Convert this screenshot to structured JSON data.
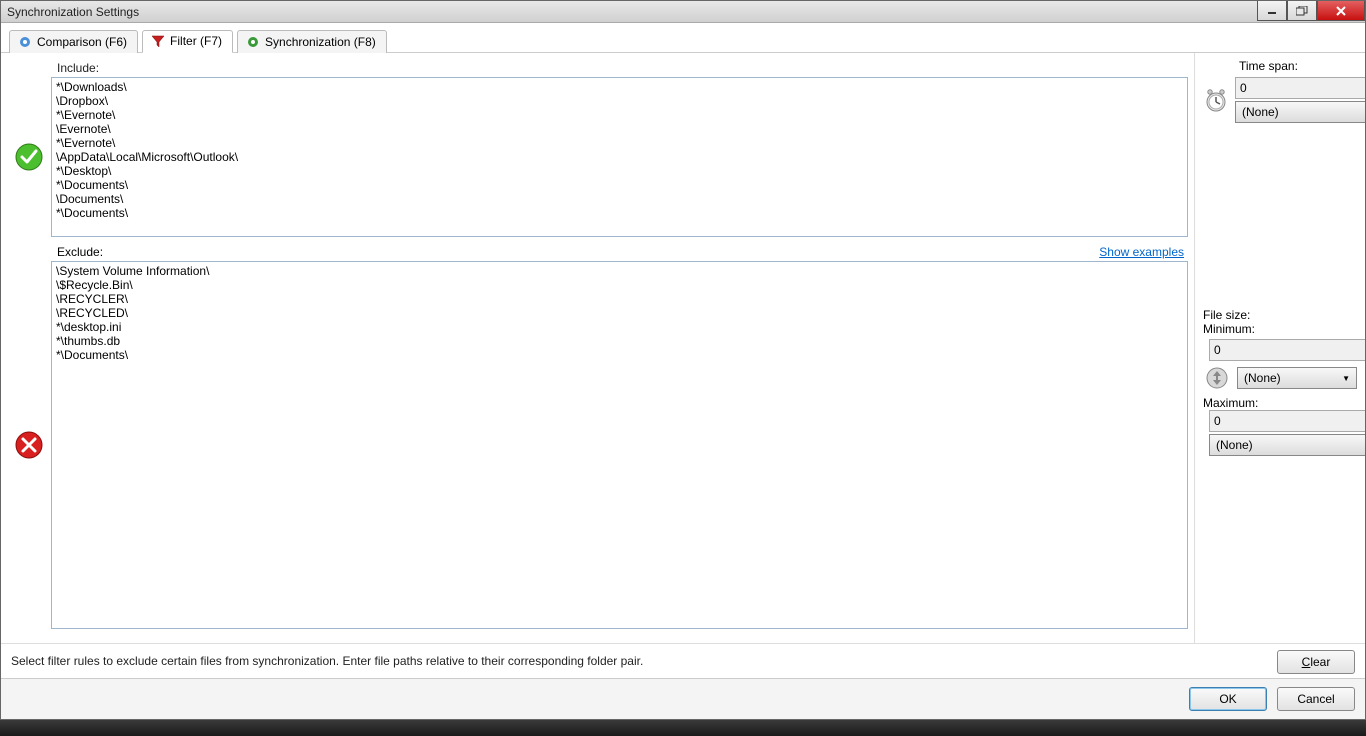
{
  "title": "Synchronization Settings",
  "tabs": {
    "comparison": "Comparison (F6)",
    "filter": "Filter (F7)",
    "synchronization": "Synchronization (F8)"
  },
  "labels": {
    "include": "Include:",
    "exclude": "Exclude:",
    "show_examples": "Show examples",
    "time_span": "Time span:",
    "file_size": "File size:",
    "minimum": "Minimum:",
    "maximum": "Maximum:"
  },
  "include_text": "*\\Downloads\\\n\\Dropbox\\\n*\\Evernote\\\n\\Evernote\\\n*\\Evernote\\\n\\AppData\\Local\\Microsoft\\Outlook\\\n*\\Desktop\\\n*\\Documents\\\n\\Documents\\\n*\\Documents\\",
  "exclude_text": "\\System Volume Information\\\n\\$Recycle.Bin\\\n\\RECYCLER\\\n\\RECYCLED\\\n*\\desktop.ini\n*\\thumbs.db\n*\\Documents\\",
  "time_span": {
    "value": "0",
    "unit": "(None)"
  },
  "file_size": {
    "min_value": "0",
    "min_unit": "(None)",
    "max_value": "0",
    "max_unit": "(None)"
  },
  "status_text": "Select filter rules to exclude certain files from synchronization. Enter file paths relative to their corresponding folder pair.",
  "buttons": {
    "clear": "Clear",
    "ok": "OK",
    "cancel": "Cancel"
  }
}
